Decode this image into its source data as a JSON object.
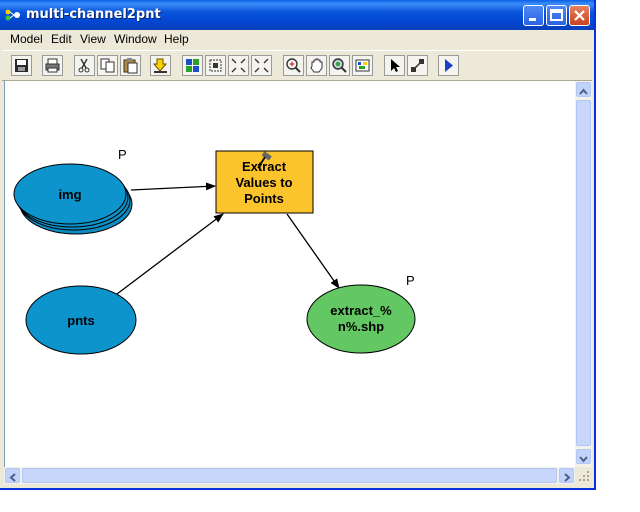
{
  "window": {
    "title": "multi-channel2pnt"
  },
  "menu": {
    "items": [
      "Model",
      "Edit",
      "View",
      "Window",
      "Help"
    ]
  },
  "toolbar": {
    "buttons": [
      "save-icon",
      "print-icon",
      "cut-icon",
      "copy-icon",
      "paste-icon",
      "add-data-icon",
      "auto-layout-icon",
      "full-extent-icon",
      "zoom-in-fixed-icon",
      "zoom-out-fixed-icon",
      "zoom-in-icon",
      "pan-icon",
      "zoom-icon",
      "overview-icon",
      "select-icon",
      "connect-icon",
      "run-icon"
    ]
  },
  "model": {
    "nodes": {
      "img": {
        "label": "img",
        "param_marker": "P"
      },
      "pnts": {
        "label": "pnts"
      },
      "tool": {
        "line1": "Extract",
        "line2": "Values to",
        "line3": "Points"
      },
      "output": {
        "line1": "extract_%",
        "line2": "n%.shp",
        "param_marker": "P"
      }
    }
  },
  "colors": {
    "input_fill": "#0e94cc",
    "tool_fill": "#fcc42c",
    "output_fill": "#63c864",
    "title_bar": "#0a54dc"
  }
}
